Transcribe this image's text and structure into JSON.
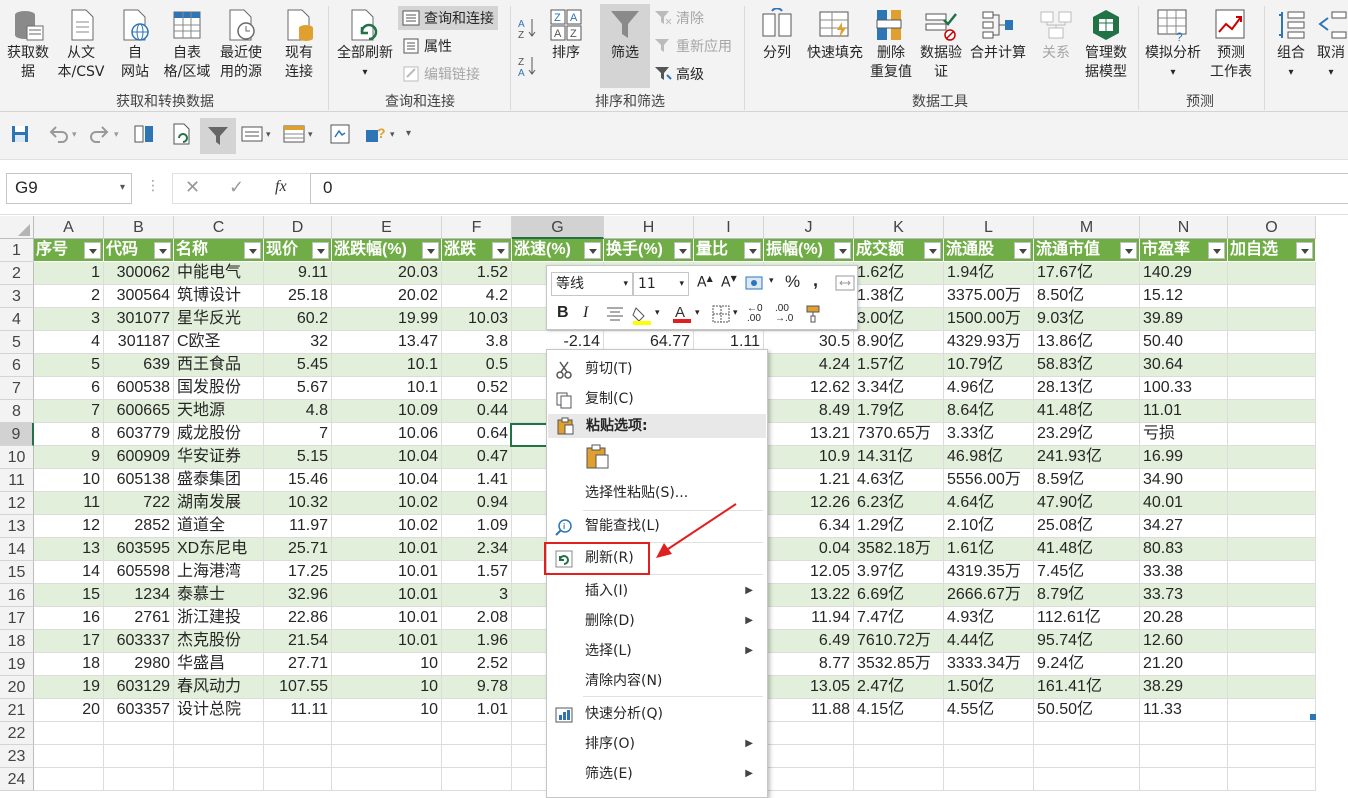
{
  "ribbon": {
    "groups": {
      "get_transform": "获取和转换数据",
      "queries": "查询和连接",
      "sort_filter": "排序和筛选",
      "data_tools": "数据工具",
      "forecast": "预测"
    },
    "get_data": [
      "获取数",
      "据"
    ],
    "from_csv": [
      "从文",
      "本/CSV"
    ],
    "from_web": [
      "自",
      "网站"
    ],
    "from_table": [
      "自表",
      "格/区域"
    ],
    "recent_sources": [
      "最近使",
      "用的源"
    ],
    "existing_conn": [
      "现有",
      "连接"
    ],
    "refresh_all": "全部刷新",
    "queries_conn": "查询和连接",
    "properties": "属性",
    "edit_links": "编辑链接",
    "sort": "排序",
    "filter": "筛选",
    "clear": "清除",
    "reapply": "重新应用",
    "advanced": "高级",
    "text_to_cols": "分列",
    "flash_fill": "快速填充",
    "remove_dup": [
      "删除",
      "重复值"
    ],
    "validation": [
      "数据验",
      "证"
    ],
    "consolidate": "合并计算",
    "relationships": "关系",
    "manage_model": [
      "管理数",
      "据模型"
    ],
    "what_if": "模拟分析",
    "forecast_sheet": [
      "预测",
      "工作表"
    ],
    "group": "组合",
    "ungroup": "取消"
  },
  "formula_bar": {
    "name_box": "G9",
    "fx": "fx",
    "formula": "0"
  },
  "columns": [
    "A",
    "B",
    "C",
    "D",
    "E",
    "F",
    "G",
    "H",
    "I",
    "J",
    "K",
    "L",
    "M",
    "N",
    "O"
  ],
  "rows": [
    "1",
    "2",
    "3",
    "4",
    "5",
    "6",
    "7",
    "8",
    "9",
    "10",
    "11",
    "12",
    "13",
    "14",
    "15",
    "16",
    "17",
    "18",
    "19",
    "20",
    "21",
    "22",
    "23",
    "24"
  ],
  "headers": [
    "序号",
    "代码",
    "名称",
    "现价",
    "涨跌幅(%)",
    "涨跌",
    "涨速(%)",
    "换手(%)",
    "量比",
    "振幅(%)",
    "成交额",
    "流通股",
    "流通市值",
    "市盈率",
    "加自选"
  ],
  "table_left": [
    [
      "1",
      "300062",
      "中能电气",
      "9.11",
      "20.03",
      "1.52"
    ],
    [
      "2",
      "300564",
      "筑博设计",
      "25.18",
      "20.02",
      "4.2"
    ],
    [
      "3",
      "301077",
      "星华反光",
      "60.2",
      "19.99",
      "10.03"
    ],
    [
      "4",
      "301187",
      "C欧圣",
      "32",
      "13.47",
      "3.8"
    ],
    [
      "5",
      "639",
      "西王食品",
      "5.45",
      "10.1",
      "0.5"
    ],
    [
      "6",
      "600538",
      "国发股份",
      "5.67",
      "10.1",
      "0.52"
    ],
    [
      "7",
      "600665",
      "天地源",
      "4.8",
      "10.09",
      "0.44"
    ],
    [
      "8",
      "603779",
      "威龙股份",
      "7",
      "10.06",
      "0.64"
    ],
    [
      "9",
      "600909",
      "华安证券",
      "5.15",
      "10.04",
      "0.47"
    ],
    [
      "10",
      "605138",
      "盛泰集团",
      "15.46",
      "10.04",
      "1.41"
    ],
    [
      "11",
      "722",
      "湖南发展",
      "10.32",
      "10.02",
      "0.94"
    ],
    [
      "12",
      "2852",
      "道道全",
      "11.97",
      "10.02",
      "1.09"
    ],
    [
      "13",
      "603595",
      "XD东尼电",
      "25.71",
      "10.01",
      "2.34"
    ],
    [
      "14",
      "605598",
      "上海港湾",
      "17.25",
      "10.01",
      "1.57"
    ],
    [
      "15",
      "1234",
      "泰慕士",
      "32.96",
      "10.01",
      "3"
    ],
    [
      "16",
      "2761",
      "浙江建投",
      "22.86",
      "10.01",
      "2.08"
    ],
    [
      "17",
      "603337",
      "杰克股份",
      "21.54",
      "10.01",
      "1.96"
    ],
    [
      "18",
      "2980",
      "华盛昌",
      "27.71",
      "10",
      "2.52"
    ],
    [
      "19",
      "603129",
      "春风动力",
      "107.55",
      "10",
      "9.78"
    ],
    [
      "20",
      "603357",
      "设计总院",
      "11.11",
      "10",
      "1.01"
    ]
  ],
  "row4_extra": {
    "g": "-2.14",
    "h": "64.77",
    "i": "1.11"
  },
  "table_right": [
    [
      "",
      "1.62亿",
      "1.94亿",
      "17.67亿",
      "140.29"
    ],
    [
      "",
      "1.38亿",
      "3375.00万",
      "8.50亿",
      "15.12"
    ],
    [
      "",
      "3.00亿",
      "1500.00万",
      "9.03亿",
      "39.89"
    ],
    [
      "30.5",
      "8.90亿",
      "4329.93万",
      "13.86亿",
      "50.40"
    ],
    [
      "4.24",
      "1.57亿",
      "10.79亿",
      "58.83亿",
      "30.64"
    ],
    [
      "12.62",
      "3.34亿",
      "4.96亿",
      "28.13亿",
      "100.33"
    ],
    [
      "8.49",
      "1.79亿",
      "8.64亿",
      "41.48亿",
      "11.01"
    ],
    [
      "13.21",
      "7370.65万",
      "3.33亿",
      "23.29亿",
      "亏损"
    ],
    [
      "10.9",
      "14.31亿",
      "46.98亿",
      "241.93亿",
      "16.99"
    ],
    [
      "1.21",
      "4.63亿",
      "5556.00万",
      "8.59亿",
      "34.90"
    ],
    [
      "12.26",
      "6.23亿",
      "4.64亿",
      "47.90亿",
      "40.01"
    ],
    [
      "6.34",
      "1.29亿",
      "2.10亿",
      "25.08亿",
      "34.27"
    ],
    [
      "0.04",
      "3582.18万",
      "1.61亿",
      "41.48亿",
      "80.83"
    ],
    [
      "12.05",
      "3.97亿",
      "4319.35万",
      "7.45亿",
      "33.38"
    ],
    [
      "13.22",
      "6.69亿",
      "2666.67万",
      "8.79亿",
      "33.73"
    ],
    [
      "11.94",
      "7.47亿",
      "4.93亿",
      "112.61亿",
      "20.28"
    ],
    [
      "6.49",
      "7610.72万",
      "4.44亿",
      "95.74亿",
      "12.60"
    ],
    [
      "8.77",
      "3532.85万",
      "3333.34万",
      "9.24亿",
      "21.20"
    ],
    [
      "13.05",
      "2.47亿",
      "1.50亿",
      "161.41亿",
      "38.29"
    ],
    [
      "11.88",
      "4.15亿",
      "4.55亿",
      "50.50亿",
      "11.33"
    ]
  ],
  "mini_toolbar": {
    "font": "等线",
    "size": "11",
    "percent": "%",
    "comma": ","
  },
  "context_menu": {
    "cut": "剪切(T)",
    "copy": "复制(C)",
    "paste_options": "粘贴选项:",
    "paste_special": "选择性粘贴(S)...",
    "smart_lookup": "智能查找(L)",
    "refresh": "刷新(R)",
    "insert": "插入(I)",
    "delete": "删除(D)",
    "select": "选择(L)",
    "clear_contents": "清除内容(N)",
    "quick_analysis": "快速分析(Q)",
    "sort": "排序(O)",
    "filter": "筛选(E)"
  },
  "colors": {
    "header_green": "#70ad47",
    "band_green": "#e2efda",
    "highlight_red": "#e0201f",
    "excel_green": "#217346"
  }
}
